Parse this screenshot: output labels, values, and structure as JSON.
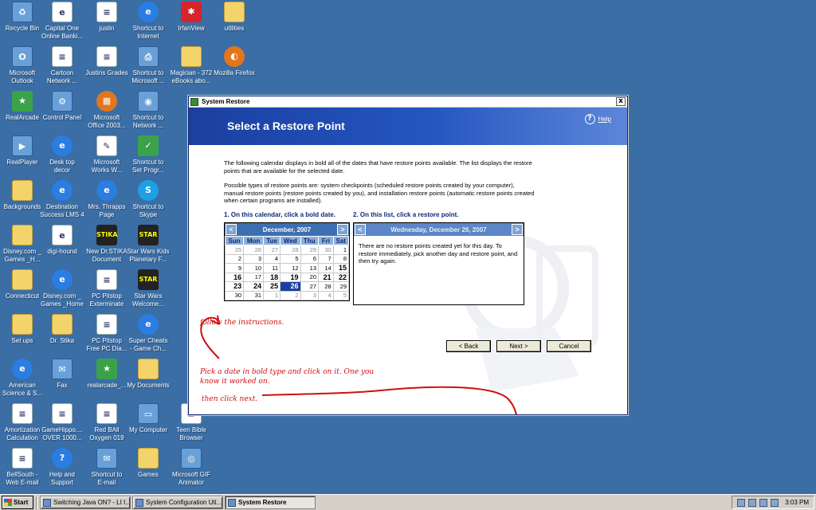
{
  "desktop": {
    "columns": [
      [
        {
          "label1": "Recycle Bin",
          "label2": "",
          "icon": "recycle-bin-icon",
          "glyph": "♻",
          "kind": "gen"
        },
        {
          "label1": "Microsoft",
          "label2": "Outlook",
          "icon": "outlook-icon",
          "glyph": "O",
          "kind": "gen"
        },
        {
          "label1": "RealArcade",
          "label2": "",
          "icon": "realarcade-icon",
          "glyph": "★",
          "kind": "green"
        },
        {
          "label1": "RealPlayer",
          "label2": "",
          "icon": "realplayer-icon",
          "glyph": "▶",
          "kind": "gen"
        },
        {
          "label1": "Backgrounds",
          "label2": "",
          "icon": "folder-icon",
          "glyph": "",
          "kind": "folder"
        },
        {
          "label1": "Disney.com _",
          "label2": "Games _H...",
          "icon": "folder-icon",
          "glyph": "",
          "kind": "folder"
        },
        {
          "label1": "Connecticut",
          "label2": "",
          "icon": "folder-icon",
          "glyph": "",
          "kind": "folder"
        },
        {
          "label1": "Set ups",
          "label2": "",
          "icon": "folder-icon",
          "glyph": "",
          "kind": "folder"
        },
        {
          "label1": "American",
          "label2": "Science & S...",
          "icon": "ie-icon",
          "glyph": "e",
          "kind": "ie"
        },
        {
          "label1": "Amortization",
          "label2": "Calculation",
          "icon": "document-icon",
          "glyph": "≡",
          "kind": "doc"
        },
        {
          "label1": "BellSouth -",
          "label2": "Web E-mail",
          "icon": "document-icon",
          "glyph": "≡",
          "kind": "doc"
        }
      ],
      [
        {
          "label1": "Capital One",
          "label2": "Online Banki...",
          "icon": "document-icon",
          "glyph": "e",
          "kind": "doc"
        },
        {
          "label1": "Cartoon",
          "label2": "Network ...",
          "icon": "document-icon",
          "glyph": "≡",
          "kind": "doc"
        },
        {
          "label1": "Control Panel",
          "label2": "",
          "icon": "control-panel-icon",
          "glyph": "⚙",
          "kind": "gen"
        },
        {
          "label1": "Desk top",
          "label2": "decor",
          "icon": "ie-icon",
          "glyph": "e",
          "kind": "ie"
        },
        {
          "label1": "Destination",
          "label2": "Success LMS 4",
          "icon": "ie-icon",
          "glyph": "e",
          "kind": "ie"
        },
        {
          "label1": "digi-hound",
          "label2": "",
          "icon": "document-icon",
          "glyph": "e",
          "kind": "doc"
        },
        {
          "label1": "Disney.com _",
          "label2": "Games _Home",
          "icon": "ie-icon",
          "glyph": "e",
          "kind": "ie"
        },
        {
          "label1": "Dr. Stika",
          "label2": "",
          "icon": "folder-icon",
          "glyph": "",
          "kind": "folder"
        },
        {
          "label1": "Fax",
          "label2": "",
          "icon": "fax-icon",
          "glyph": "✉",
          "kind": "gen"
        },
        {
          "label1": "GameHippo....",
          "label2": "OVER 1000...",
          "icon": "document-icon",
          "glyph": "≡",
          "kind": "doc"
        },
        {
          "label1": "Help and",
          "label2": "Support",
          "icon": "help-icon",
          "glyph": "?",
          "kind": "ie"
        }
      ],
      [
        {
          "label1": "justin",
          "label2": "",
          "icon": "document-icon",
          "glyph": "≡",
          "kind": "doc"
        },
        {
          "label1": "Justins Grades",
          "label2": "",
          "icon": "document-icon",
          "glyph": "≡",
          "kind": "doc"
        },
        {
          "label1": "Microsoft",
          "label2": "Office 2003...",
          "icon": "office-icon",
          "glyph": "▦",
          "kind": "orange"
        },
        {
          "label1": "Microsoft",
          "label2": "Works W...",
          "icon": "works-icon",
          "glyph": "✎",
          "kind": "doc"
        },
        {
          "label1": "Mrs. Thrapps",
          "label2": "Page",
          "icon": "ie-icon",
          "glyph": "e",
          "kind": "ie"
        },
        {
          "label1": "New Dr.STIKA",
          "label2": "Document",
          "icon": "stika-icon",
          "glyph": "STIKA",
          "kind": "dark"
        },
        {
          "label1": "PC Pitstop",
          "label2": "Exterminate",
          "icon": "document-icon",
          "glyph": "≡",
          "kind": "doc"
        },
        {
          "label1": "PC Pitstop",
          "label2": "Free PC Dia...",
          "icon": "document-icon",
          "glyph": "≡",
          "kind": "doc"
        },
        {
          "label1": "realarcade_...",
          "label2": "",
          "icon": "realarcade-icon",
          "glyph": "★",
          "kind": "green"
        },
        {
          "label1": "Red BAll",
          "label2": "Oxygen 019",
          "icon": "document-icon",
          "glyph": "≡",
          "kind": "doc"
        },
        {
          "label1": "Shortcut to",
          "label2": "E-mail",
          "icon": "email-icon",
          "glyph": "✉",
          "kind": "gen"
        }
      ],
      [
        {
          "label1": "Shortcut to",
          "label2": "Internet",
          "icon": "ie-icon",
          "glyph": "e",
          "kind": "ie"
        },
        {
          "label1": "Shortcut to",
          "label2": "Microsoft ...",
          "icon": "printer-icon",
          "glyph": "⎙",
          "kind": "gen"
        },
        {
          "label1": "Shortcut to",
          "label2": "Network ...",
          "icon": "network-icon",
          "glyph": "◉",
          "kind": "gen"
        },
        {
          "label1": "Shortcut to",
          "label2": "Set Progr...",
          "icon": "programs-icon",
          "glyph": "✓",
          "kind": "green"
        },
        {
          "label1": "Shortcut to",
          "label2": "Skype",
          "icon": "skype-icon",
          "glyph": "S",
          "kind": "skype"
        },
        {
          "label1": "Star Wars Kids",
          "label2": "Planetary F...",
          "icon": "starwars-icon",
          "glyph": "STAR",
          "kind": "dark"
        },
        {
          "label1": "Star Wars",
          "label2": "Welcome...",
          "icon": "starwars-icon",
          "glyph": "STAR",
          "kind": "dark"
        },
        {
          "label1": "Super Cheats",
          "label2": "- Game Ch...",
          "icon": "ie-icon",
          "glyph": "e",
          "kind": "ie"
        },
        {
          "label1": "My Documents",
          "label2": "",
          "icon": "my-documents-icon",
          "glyph": "",
          "kind": "folder"
        },
        {
          "label1": "My Computer",
          "label2": "",
          "icon": "my-computer-icon",
          "glyph": "▭",
          "kind": "gen"
        },
        {
          "label1": "Games",
          "label2": "",
          "icon": "folder-icon",
          "glyph": "",
          "kind": "folder"
        }
      ],
      [
        {
          "label1": "IrfanView",
          "label2": "",
          "icon": "irfanview-icon",
          "glyph": "✱",
          "kind": "red"
        },
        {
          "label1": "Magician - 372",
          "label2": "eBooks abo...",
          "icon": "folder-icon",
          "glyph": "",
          "kind": "folder"
        },
        {
          "label1": "",
          "label2": "",
          "icon": "hidden",
          "glyph": "",
          "kind": "none"
        },
        {
          "label1": "",
          "label2": "",
          "icon": "hidden",
          "glyph": "",
          "kind": "none"
        },
        {
          "label1": "",
          "label2": "",
          "icon": "hidden",
          "glyph": "",
          "kind": "none"
        },
        {
          "label1": "",
          "label2": "",
          "icon": "hidden",
          "glyph": "",
          "kind": "none"
        },
        {
          "label1": "",
          "label2": "",
          "icon": "hidden",
          "glyph": "",
          "kind": "none"
        },
        {
          "label1": "",
          "label2": "",
          "icon": "hidden",
          "glyph": "",
          "kind": "none"
        },
        {
          "label1": "",
          "label2": "",
          "icon": "hidden",
          "glyph": "",
          "kind": "none"
        },
        {
          "label1": "Teen Bible",
          "label2": "Browser",
          "icon": "document-icon",
          "glyph": "≡",
          "kind": "doc"
        },
        {
          "label1": "Microsoft GIF",
          "label2": "Animator",
          "icon": "gif-animator-icon",
          "glyph": "◎",
          "kind": "gen"
        }
      ],
      [
        {
          "label1": "utilities",
          "label2": "",
          "icon": "folder-icon",
          "glyph": "",
          "kind": "folder"
        },
        {
          "label1": "Mozilla Firefox",
          "label2": "",
          "icon": "firefox-icon",
          "glyph": "◐",
          "kind": "orange"
        }
      ]
    ]
  },
  "window": {
    "title": "System Restore",
    "close": "x",
    "header_title": "Select a Restore Point",
    "help_label": "Help",
    "intro1": "The following calendar displays in bold all of the dates that have restore points available. The list displays the restore points that are available for the selected date.",
    "intro2": "Possible types of restore points are: system checkpoints (scheduled restore points created by your computer), manual restore points (restore points created by you), and installation restore points (automatic restore points created when certain programs are installed).",
    "step1": "1. On this calendar, click a bold date.",
    "step2": "2. On this list, click a restore point.",
    "calendar": {
      "month": "December, 2007",
      "prev": "<",
      "next": ">",
      "weekdays": [
        "Sun",
        "Mon",
        "Tue",
        "Wed",
        "Thu",
        "Fri",
        "Sat"
      ],
      "weeks": [
        [
          {
            "d": "25",
            "s": "dim"
          },
          {
            "d": "26",
            "s": "dim"
          },
          {
            "d": "27",
            "s": "dim"
          },
          {
            "d": "28",
            "s": "dim"
          },
          {
            "d": "29",
            "s": "dim"
          },
          {
            "d": "30",
            "s": "dim"
          },
          {
            "d": "1",
            "s": ""
          }
        ],
        [
          {
            "d": "2",
            "s": ""
          },
          {
            "d": "3",
            "s": ""
          },
          {
            "d": "4",
            "s": ""
          },
          {
            "d": "5",
            "s": ""
          },
          {
            "d": "6",
            "s": ""
          },
          {
            "d": "7",
            "s": ""
          },
          {
            "d": "8",
            "s": ""
          }
        ],
        [
          {
            "d": "9",
            "s": ""
          },
          {
            "d": "10",
            "s": ""
          },
          {
            "d": "11",
            "s": ""
          },
          {
            "d": "12",
            "s": ""
          },
          {
            "d": "13",
            "s": ""
          },
          {
            "d": "14",
            "s": ""
          },
          {
            "d": "15",
            "s": "bold"
          }
        ],
        [
          {
            "d": "16",
            "s": "bold"
          },
          {
            "d": "17",
            "s": ""
          },
          {
            "d": "18",
            "s": "bold"
          },
          {
            "d": "19",
            "s": "bold"
          },
          {
            "d": "20",
            "s": ""
          },
          {
            "d": "21",
            "s": "bold"
          },
          {
            "d": "22",
            "s": "bold"
          }
        ],
        [
          {
            "d": "23",
            "s": "bold"
          },
          {
            "d": "24",
            "s": "bold"
          },
          {
            "d": "25",
            "s": "bold"
          },
          {
            "d": "26",
            "s": "sel"
          },
          {
            "d": "27",
            "s": ""
          },
          {
            "d": "28",
            "s": ""
          },
          {
            "d": "29",
            "s": ""
          }
        ],
        [
          {
            "d": "30",
            "s": ""
          },
          {
            "d": "31",
            "s": ""
          },
          {
            "d": "1",
            "s": "dim"
          },
          {
            "d": "2",
            "s": "dim"
          },
          {
            "d": "3",
            "s": "dim"
          },
          {
            "d": "4",
            "s": "dim"
          },
          {
            "d": "5",
            "s": "dim"
          }
        ]
      ]
    },
    "list": {
      "date": "Wednesday, December 26, 2007",
      "prev": "<",
      "next": ">",
      "message": "There are no restore points created yet for this day. To restore immediately, pick another day and restore point, and then try again."
    },
    "annotations": {
      "line1": "Pick a date in bold type and click on it. One you",
      "line2": "know it worked on.",
      "line3": "then click next.",
      "line4": "follow the instructions."
    },
    "buttons": {
      "back": "< Back",
      "next": "Next >",
      "cancel": "Cancel"
    }
  },
  "taskbar": {
    "start": "Start",
    "tasks": [
      {
        "label": "Switching Java ON? - LI I...",
        "active": false
      },
      {
        "label": "System Configuration Uti...",
        "active": false
      },
      {
        "label": "System Restore",
        "active": true
      }
    ],
    "clock": "3:03 PM"
  },
  "colors": {
    "desktop": "#3a6ea5",
    "header": "#1b3fa0",
    "annotation": "#d01010"
  }
}
